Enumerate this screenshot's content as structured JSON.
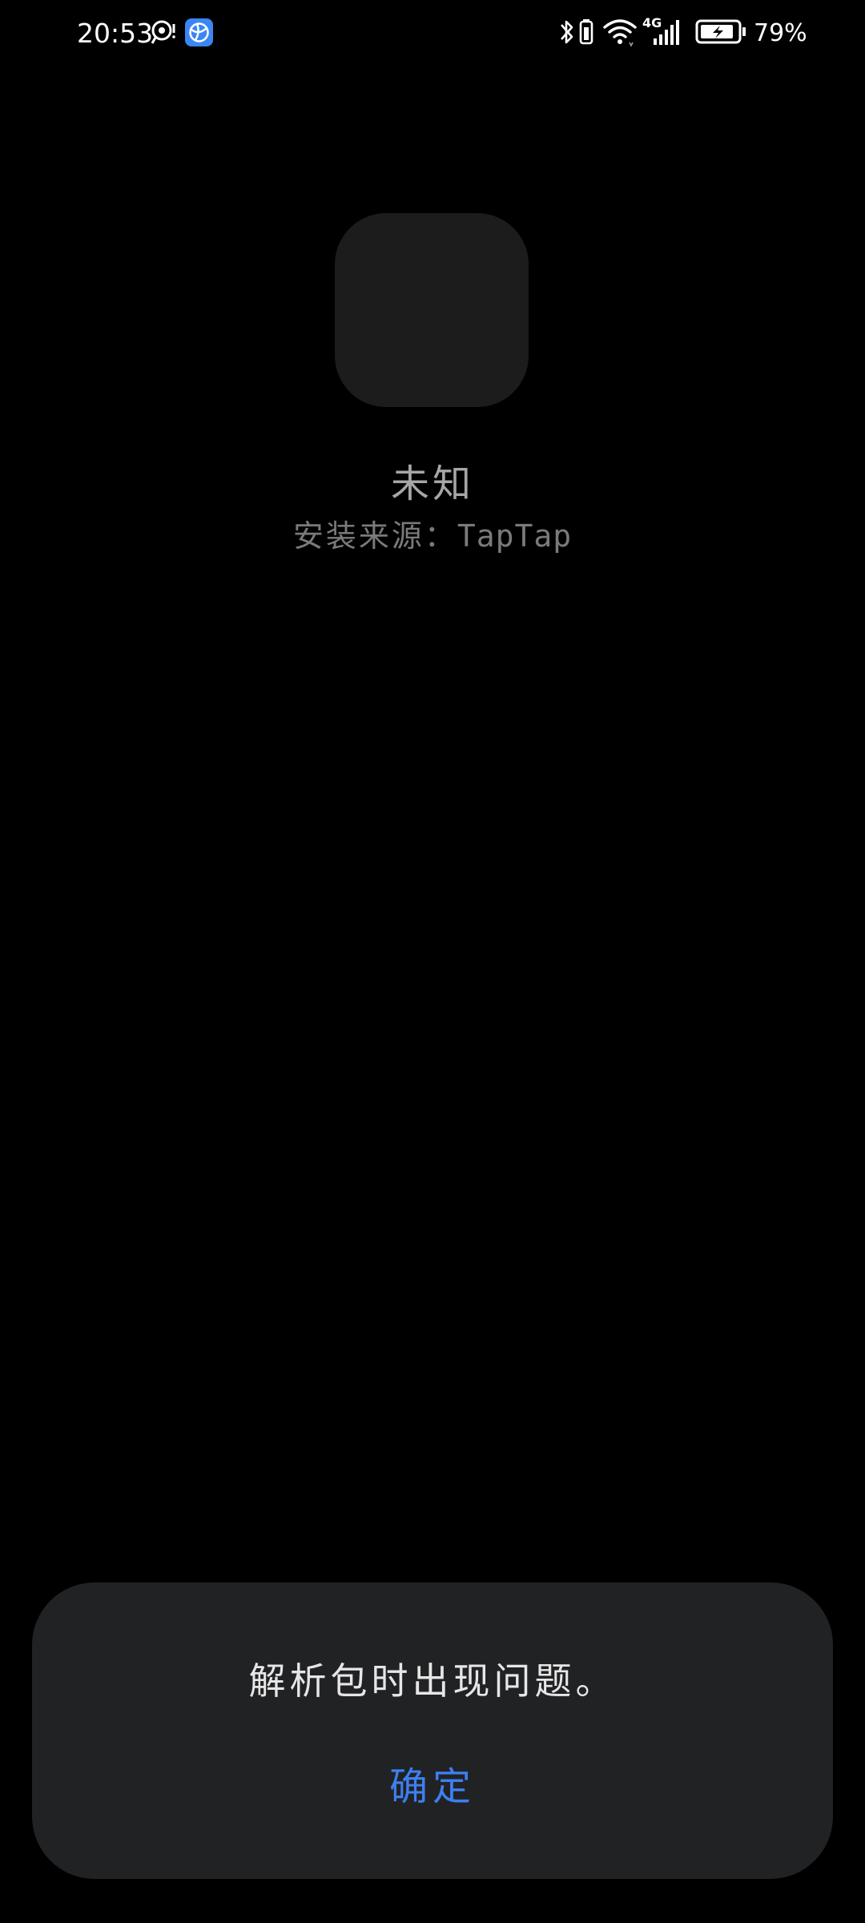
{
  "status_bar": {
    "time": "20:53",
    "battery_percent": "79%",
    "network_label": "4G",
    "icons": [
      "location-icon",
      "app-notification-icon",
      "bluetooth-icon",
      "battery-saver-icon",
      "wifi-icon",
      "signal-icon",
      "battery-icon"
    ],
    "notification_icon_color": "#3a86f5"
  },
  "app": {
    "name": "未知",
    "install_source_label": "安装来源：",
    "install_source_value": "TapTap",
    "icon_placeholder_color": "#1c1c1d"
  },
  "dialog": {
    "message": "解析包时出现问题。",
    "confirm_label": "确定",
    "accent_color": "#3d7ff0"
  }
}
